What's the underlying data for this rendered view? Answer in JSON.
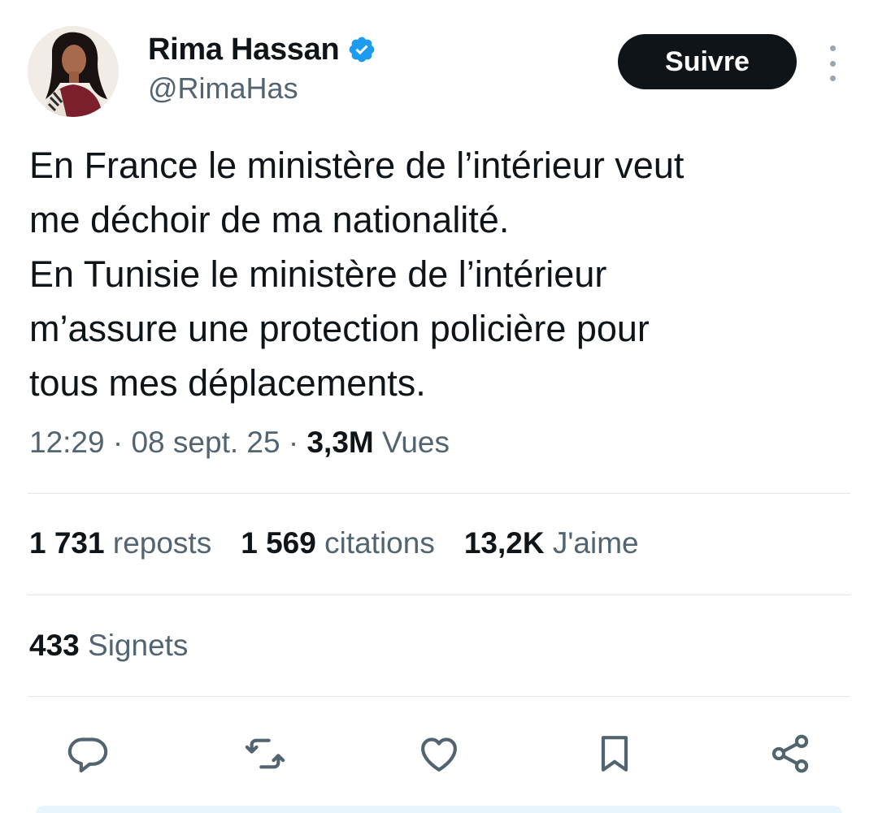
{
  "author": {
    "display_name": "Rima Hassan",
    "handle": "@RimaHas",
    "verified_icon": "verified-badge-icon",
    "verified_color": "#1d9bf0"
  },
  "follow_button": {
    "label": "Suivre"
  },
  "more_icon": "more-vertical-icon",
  "tweet": {
    "lines": [
      "En France le ministère de l’intérieur veut",
      "me déchoir de ma nationalité.",
      "En Tunisie le ministère de l’intérieur",
      "m’assure une protection policière pour",
      "tous mes déplacements."
    ]
  },
  "meta": {
    "time": "12:29",
    "separator": "·",
    "date": "08 sept. 25",
    "views_count": "3,3M",
    "views_label": "Vues"
  },
  "stats": {
    "reposts": {
      "count": "1 731",
      "label": "reposts"
    },
    "quotes": {
      "count": "1 569",
      "label": "citations"
    },
    "likes": {
      "count": "13,2K",
      "label": "J'aime"
    },
    "bookmarks": {
      "count": "433",
      "label": "Signets"
    }
  },
  "actions": [
    {
      "name": "reply",
      "icon": "reply-icon"
    },
    {
      "name": "repost",
      "icon": "repost-icon"
    },
    {
      "name": "like",
      "icon": "heart-icon"
    },
    {
      "name": "bookmark",
      "icon": "bookmark-icon"
    },
    {
      "name": "share",
      "icon": "share-icon"
    }
  ],
  "colors": {
    "text": "#0f1419",
    "secondary": "#536471",
    "icon": "#536471",
    "divider": "#e3e6e9",
    "button_bg": "#0f1419",
    "button_text": "#ffffff"
  }
}
